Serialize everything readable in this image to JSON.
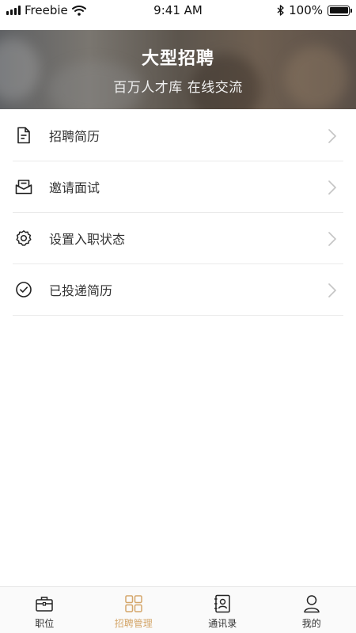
{
  "status_bar": {
    "carrier": "Freebie",
    "time": "9:41 AM",
    "battery": "100%",
    "battery_level": 1.0
  },
  "banner": {
    "title": "大型招聘",
    "subtitle": "百万人才库 在线交流"
  },
  "menu": {
    "items": [
      {
        "label": "招聘简历",
        "icon": "resume-icon"
      },
      {
        "label": "邀请面试",
        "icon": "envelope-icon"
      },
      {
        "label": "设置入职状态",
        "icon": "settings-icon"
      },
      {
        "label": "已投递简历",
        "icon": "check-circle-icon"
      }
    ]
  },
  "tabbar": {
    "tabs": [
      {
        "label": "职位",
        "icon": "briefcase-icon",
        "active": false
      },
      {
        "label": "招聘管理",
        "icon": "grid-icon",
        "active": true
      },
      {
        "label": "通讯录",
        "icon": "contacts-icon",
        "active": false
      },
      {
        "label": "我的",
        "icon": "user-icon",
        "active": false
      }
    ]
  },
  "colors": {
    "accent": "#d4a66a",
    "text": "#333333",
    "divider": "#eaeaea",
    "chevron": "#c4c4c4"
  }
}
